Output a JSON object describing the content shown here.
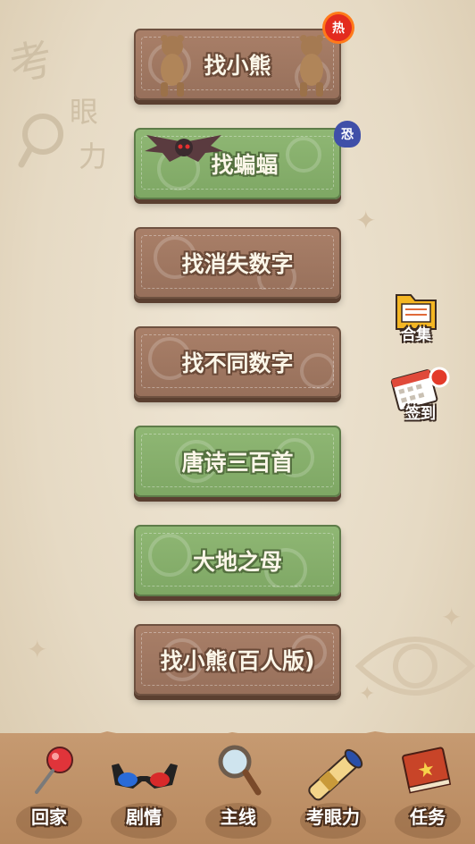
{
  "background": {
    "logo": {
      "char1": "考",
      "char2": "眼",
      "char3": "力"
    }
  },
  "menu": [
    {
      "label": "找小熊",
      "color": "brown",
      "badge": "热",
      "decoration": "bear-icon"
    },
    {
      "label": "找蝙蝠",
      "color": "green",
      "badge": "恐",
      "decoration": "bat-icon"
    },
    {
      "label": "找消失数字",
      "color": "brown"
    },
    {
      "label": "找不同数字",
      "color": "brown"
    },
    {
      "label": "唐诗三百首",
      "color": "green"
    },
    {
      "label": "大地之母",
      "color": "green"
    },
    {
      "label": "找小熊(百人版)",
      "color": "brown"
    }
  ],
  "side": {
    "collection_label": "合集",
    "checkin_label": "签到"
  },
  "tabs": [
    {
      "label": "回家",
      "icon": "pushpin-icon"
    },
    {
      "label": "剧情",
      "icon": "3d-glasses-icon"
    },
    {
      "label": "主线",
      "icon": "magnifier-icon"
    },
    {
      "label": "考眼力",
      "icon": "telescope-icon",
      "active": true
    },
    {
      "label": "任务",
      "icon": "book-icon"
    }
  ],
  "colors": {
    "brown_button": "#a27a64",
    "green_button": "#86ae6b",
    "hot_badge": "#e32b1f",
    "bottom_bar": "#c69a71"
  }
}
